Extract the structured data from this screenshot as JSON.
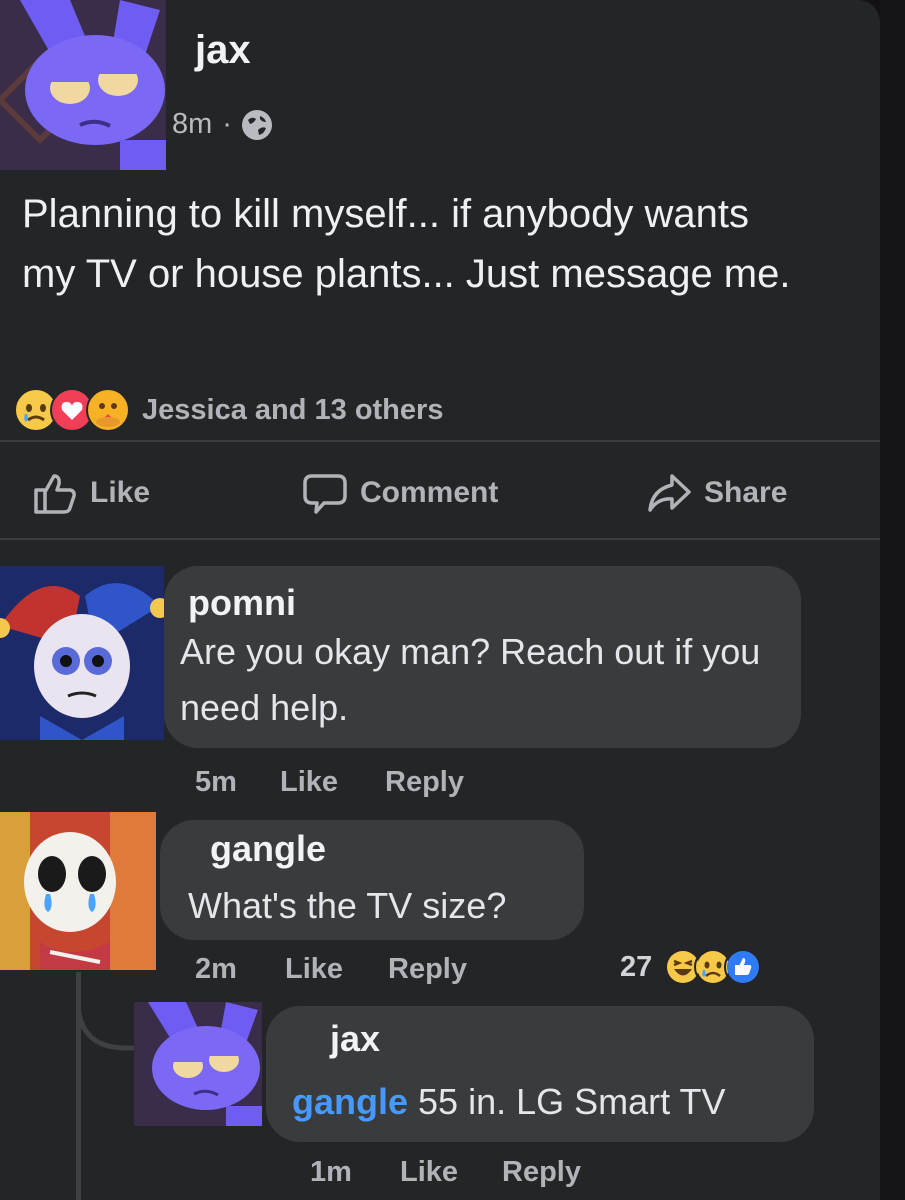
{
  "post": {
    "author": "jax",
    "time": "8m",
    "separator": "·",
    "privacy_icon": "globe-icon",
    "text": "Planning to kill myself... if anybody wants my TV or house plants... Just message me.",
    "reactions": {
      "icons": [
        "sad-reaction-icon",
        "love-reaction-icon",
        "care-reaction-icon"
      ],
      "summary": "Jessica and 13 others"
    },
    "actions": {
      "like": "Like",
      "comment": "Comment",
      "share": "Share"
    }
  },
  "comments": [
    {
      "author": "pomni",
      "text": "Are you okay man? Reach out if you need help.",
      "time": "5m",
      "like": "Like",
      "reply": "Reply"
    },
    {
      "author": "gangle",
      "text": "What's the TV size?",
      "time": "2m",
      "like": "Like",
      "reply": "Reply",
      "reaction_count": "27",
      "reaction_icons": [
        "haha-reaction-icon",
        "sad-reaction-icon",
        "like-reaction-icon"
      ]
    },
    {
      "author": "jax",
      "mention": "gangle",
      "text": "55 in. LG Smart TV",
      "time": "1m",
      "like": "Like",
      "reply": "Reply"
    }
  ],
  "colors": {
    "background": "#242527",
    "bubble": "#3a3b3c",
    "mention": "#4599ff",
    "muted_text": "#b0b3b8"
  }
}
